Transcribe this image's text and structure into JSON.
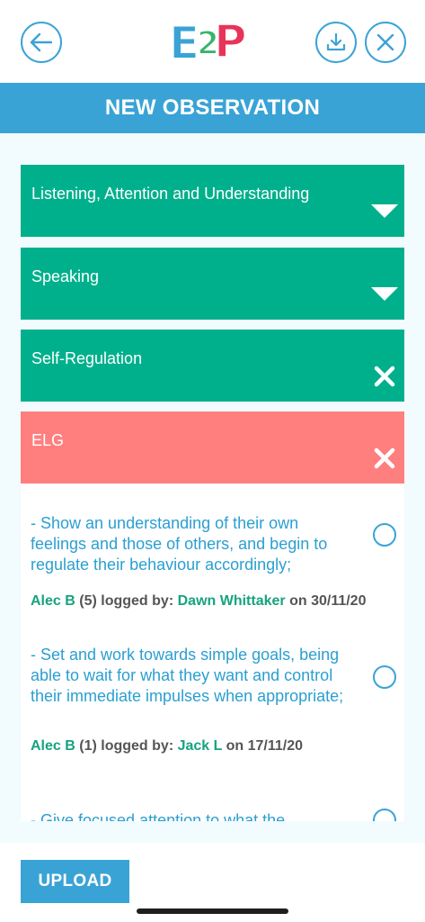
{
  "app": {
    "logo_text": "E2P",
    "logo_parts": [
      "E",
      "2",
      "P"
    ],
    "logo_colors": {
      "e": "#3aa3d6",
      "two": "#36b56a",
      "p": "#e8345a"
    }
  },
  "topbar": {
    "back_icon": "back-arrow-icon",
    "download_icon": "download-icon",
    "close_icon": "close-icon"
  },
  "header": {
    "title": "NEW OBSERVATION",
    "color": "#3aa3d6"
  },
  "sections": [
    {
      "label": "Listening, Attention and Understanding",
      "state": "collapsed",
      "icon": "caret-down-icon",
      "color": "#00b08c"
    },
    {
      "label": "Speaking",
      "state": "collapsed",
      "icon": "caret-down-icon",
      "color": "#00b08c"
    },
    {
      "label": "Self-Regulation",
      "state": "expanded",
      "icon": "close-x-icon",
      "color": "#00b08c"
    },
    {
      "label": "ELG",
      "state": "expanded",
      "icon": "close-x-icon",
      "color": "#ff7f7f"
    }
  ],
  "goals": [
    {
      "text": "- Show an understanding of their own feelings and those of others, and begin to regulate their behaviour accordingly;",
      "child": "Alec B",
      "count": "(5)",
      "logged_by_label": "logged by:",
      "author": "Dawn Whittaker",
      "on_label": "on",
      "date": "30/11/20",
      "selected": false
    },
    {
      "text": "- Set and work towards simple goals, being able to wait for what they want and control their immediate impulses when appropriate;",
      "child": "Alec B",
      "count": "(1)",
      "logged_by_label": "logged by:",
      "author": "Jack L",
      "on_label": "on",
      "date": "17/11/20",
      "selected": false
    },
    {
      "text": "- Give focused attention to what the",
      "selected": false
    }
  ],
  "footer": {
    "upload_label": "UPLOAD"
  }
}
